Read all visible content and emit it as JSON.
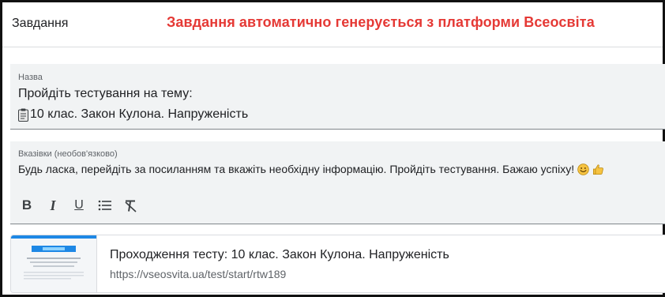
{
  "header": {
    "title": "Завдання",
    "notice": "Завдання автоматично генерується з платформи Всеосвіта",
    "notice_color": "#e53935"
  },
  "title_field": {
    "label": "Назва",
    "line1": "Пройдіть тестування на тему:",
    "line2": "10 клас. Закон Кулона. Напруженість",
    "icon": "clipboard-icon"
  },
  "description_field": {
    "label": "Вказівки (необов'язково)",
    "text": "Будь ласка, перейдіть за посиланням та вкажіть необхідну інформацію. Пройдіть тестування. Бажаю успіху!",
    "emojis": [
      "smile-emoji",
      "thumbs-up-emoji"
    ]
  },
  "toolbar": {
    "bold": "B",
    "italic": "I",
    "underline": "U",
    "list_icon": "bulleted-list-icon",
    "clear_icon": "clear-formatting-icon"
  },
  "attachment": {
    "title": "Проходження тесту: 10 клас. Закон Кулона. Напруженість",
    "url": "https://vseosvita.ua/test/start/rtw189",
    "thumbnail_icon": "page-thumbnail"
  }
}
